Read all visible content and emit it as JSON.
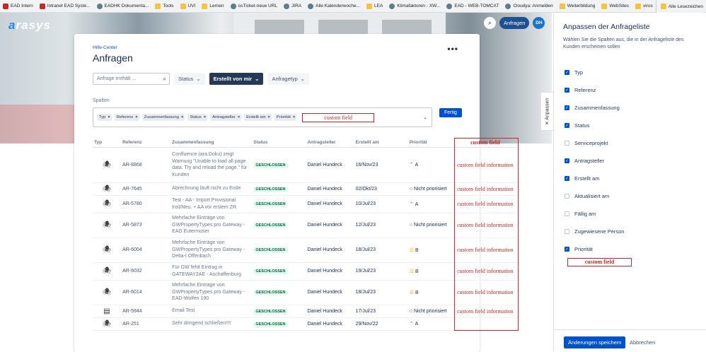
{
  "bookmarks": [
    {
      "label": "EAD Intern",
      "icon": "red"
    },
    {
      "label": "Intranet EAD Syste...",
      "icon": "red"
    },
    {
      "label": "EADHK Dokumenta...",
      "icon": "site"
    },
    {
      "label": "Tools",
      "icon": "folder"
    },
    {
      "label": "UVI",
      "icon": "folder"
    },
    {
      "label": "Lernen",
      "icon": "folder"
    },
    {
      "label": "osTicket-neue URL",
      "icon": "site"
    },
    {
      "label": "JIRA",
      "icon": "site"
    },
    {
      "label": "Alle Kalenderwoche...",
      "icon": "site"
    },
    {
      "label": "LEA",
      "icon": "folder"
    },
    {
      "label": "Klimafaktoren - XW...",
      "icon": "site"
    },
    {
      "label": "EAD - WEB-TOMCAT",
      "icon": "site"
    },
    {
      "label": "Cloudya: Anmelden",
      "icon": "site"
    },
    {
      "label": "Weiterbildung",
      "icon": "folder"
    },
    {
      "label": "WebSites",
      "icon": "folder"
    },
    {
      "label": "virus",
      "icon": "folder"
    }
  ],
  "bookmarks_right": "Alle Lesezeichen",
  "logo": {
    "prefix": "a",
    "rest": "rasys"
  },
  "topbar": {
    "requests_label": "Anfragen",
    "avatar": "DH"
  },
  "page": {
    "breadcrumb": "Hilfe-Center",
    "title": "Anfragen",
    "more": "•••"
  },
  "filters": {
    "search_placeholder": "Anfrage enthält ...",
    "status": "Status",
    "created_by": "Erstellt von mir",
    "type": "Anfragetyp"
  },
  "columns_label": "Spalten",
  "chips": [
    "Typ",
    "Referenz",
    "Zusammenfassung",
    "Status",
    "Antragsteller",
    "Erstellt am",
    "Priorität"
  ],
  "custom_field": "custom field",
  "done_label": "Fertig",
  "table": {
    "headers": [
      "Typ",
      "Referenz",
      "Zusammenfassung",
      "Status",
      "Antragsteller",
      "Erstellt am",
      "Priorität",
      "custom field"
    ],
    "rows": [
      {
        "ref": "AR-8868",
        "summary": "Confluence (ara.Doku) zeigt Warnung \"Unable to load all page data. Try and reload the page.\" für Kunden",
        "status": "GESCHLOSSEN",
        "requester": "Daniel Hundeck",
        "created": "16/Nov/23",
        "priority": "A",
        "prio_icon": "up",
        "cf": "custom field information",
        "type_icon": "bug"
      },
      {
        "ref": "AR-7645",
        "summary": "Abrechnung läuft nicht zu Ende",
        "status": "GESCHLOSSEN",
        "requester": "Daniel Hundeck",
        "created": "02/Okt/23",
        "priority": "Nicht priorisiert",
        "prio_icon": "none",
        "cf": "custom field information",
        "type_icon": "bug"
      },
      {
        "ref": "AR-5780",
        "summary": "Test - AA - Import Provisional Inst/Neu. + AA vor erstem ZR",
        "status": "GESCHLOSSEN",
        "requester": "Daniel Hundeck",
        "created": "10/Jul/23",
        "priority": "A",
        "prio_icon": "up",
        "cf": "custom field information",
        "type_icon": "bug"
      },
      {
        "ref": "AR-5873",
        "summary": "Mehrfache Einträge von GWPropertyTypes pro Gateway - EAD Eutermoser",
        "status": "GESCHLOSSEN",
        "requester": "Daniel Hundeck",
        "created": "12/Jul/23",
        "priority": "Nicht priorisiert",
        "prio_icon": "none",
        "cf": "custom field information",
        "type_icon": "bug"
      },
      {
        "ref": "AR-6004",
        "summary": "Mehrfache Einträge von GWPropertyTypes pro Gateway - Delta-t Offenbach",
        "status": "GESCHLOSSEN",
        "requester": "Daniel Hundeck",
        "created": "18/Jul/23",
        "priority": "B",
        "prio_icon": "mid",
        "cf": "custom field information",
        "type_icon": "bug"
      },
      {
        "ref": "AR-6032",
        "summary": "Für GW fehlt Eintrag in GATEWAY2AE - Aschaffenburg",
        "status": "GESCHLOSSEN",
        "requester": "Daniel Hundeck",
        "created": "19/Jul/23",
        "priority": "B",
        "prio_icon": "mid",
        "cf": "custom field information",
        "type_icon": "bug"
      },
      {
        "ref": "AR-6014",
        "summary": "Mehrfache Einträge von GWPropertyTypes pro Gateway - EAD-Wolfen 190",
        "status": "GESCHLOSSEN",
        "requester": "Daniel Hundeck",
        "created": "18/Jul/23",
        "priority": "B",
        "prio_icon": "mid",
        "cf": "custom field information",
        "type_icon": "bug"
      },
      {
        "ref": "AR-5944",
        "summary": "Email Test",
        "status": "GESCHLOSSEN",
        "requester": "Daniel Hundeck",
        "created": "17/Jul/23",
        "priority": "Nicht priorisiert",
        "prio_icon": "none",
        "cf": "custom field information",
        "type_icon": "list"
      },
      {
        "ref": "AR-251",
        "summary": "Sehr dringend schließen!!!!",
        "status": "GESCHLOSSEN",
        "requester": "Daniel Hundeck",
        "created": "29/Nov/22",
        "priority": "A",
        "prio_icon": "up",
        "cf": "",
        "type_icon": "bug"
      }
    ]
  },
  "side_tab": "Anpassen",
  "side": {
    "title": "Anpassen der Anfrageliste",
    "description": "Wählen Sie die Spalten aus, die in der Anfrageliste des Kunden erscheinen sollen",
    "items": [
      {
        "label": "Typ",
        "checked": true
      },
      {
        "label": "Referenz",
        "checked": true
      },
      {
        "label": "Zusammenfassung",
        "checked": true
      },
      {
        "label": "Status",
        "checked": true
      },
      {
        "label": "Serviceprojekt",
        "checked": false
      },
      {
        "label": "Antragsteller",
        "checked": true
      },
      {
        "label": "Erstellt am",
        "checked": true
      },
      {
        "label": "Aktualisiert am",
        "checked": false
      },
      {
        "label": "Fällig am",
        "checked": false
      },
      {
        "label": "Zugewiesene Person",
        "checked": false
      },
      {
        "label": "Priorität",
        "checked": true
      }
    ],
    "save_label": "Änderungen speichern",
    "cancel_label": "Abbrechen"
  },
  "colors": {
    "accent": "#0052cc",
    "annotation": "#c62828",
    "status_bg": "#e3fcef",
    "status_fg": "#006644"
  }
}
